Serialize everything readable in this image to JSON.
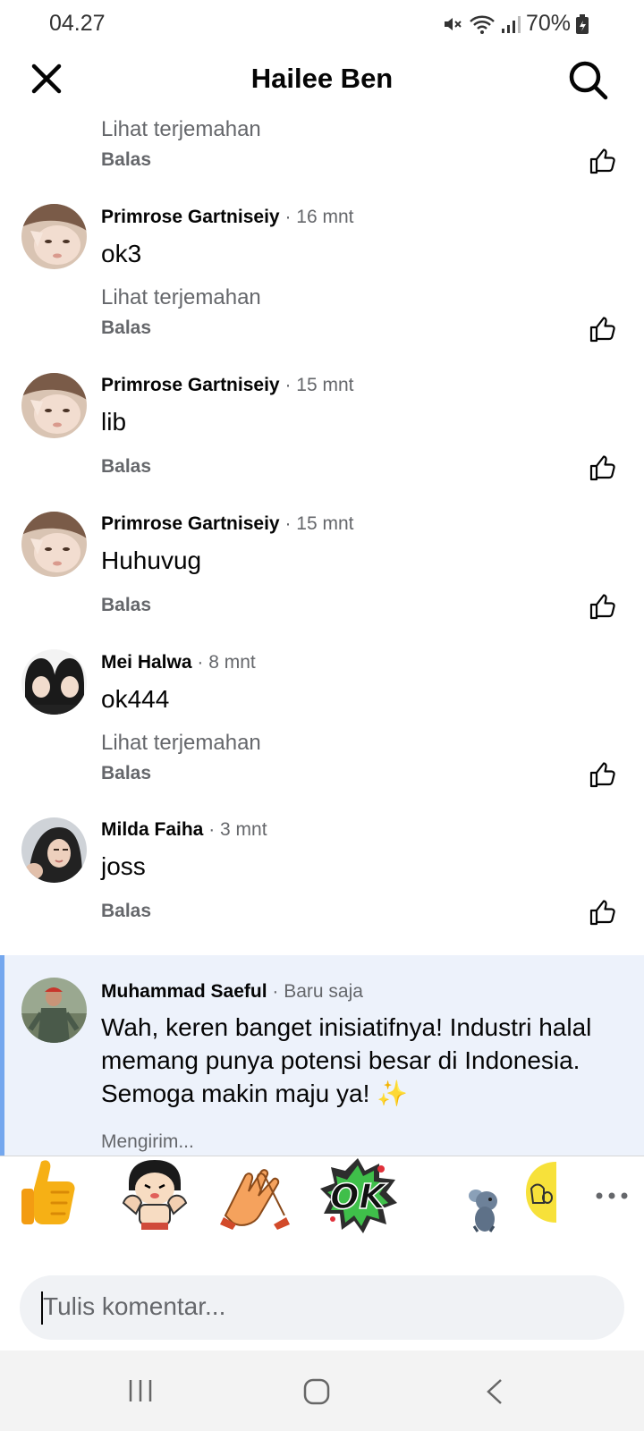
{
  "status": {
    "time": "04.27",
    "battery": "70%"
  },
  "header": {
    "title": "Hailee Ben"
  },
  "top_fragment": {
    "translate": "Lihat terjemahan",
    "reply": "Balas"
  },
  "comments": [
    {
      "author": "Primrose Gartniseiy",
      "time": "· 16 mnt",
      "text": "ok3",
      "translate": "Lihat terjemahan",
      "reply": "Balas"
    },
    {
      "author": "Primrose Gartniseiy",
      "time": "· 15 mnt",
      "text": "lib",
      "reply": "Balas"
    },
    {
      "author": "Primrose Gartniseiy",
      "time": "· 15 mnt",
      "text": "Huhuvug",
      "reply": "Balas"
    },
    {
      "author": "Mei Halwa",
      "time": "· 8 mnt",
      "text": "ok444",
      "translate": "Lihat terjemahan",
      "reply": "Balas"
    },
    {
      "author": "Milda Faiha",
      "time": "· 3 mnt",
      "text": "joss",
      "reply": "Balas"
    }
  ],
  "new_comment": {
    "author": "Muhammad Saeful",
    "time": "· Baru saja",
    "text": "Wah, keren banget inisiatifnya! Industri halal memang punya potensi besar di Indonesia. Semoga makin maju ya! ✨",
    "status": "Mengirim..."
  },
  "stickers": [
    "thumbs-up-sticker",
    "flexing-boy-sticker",
    "clapping-hands-sticker",
    "ok-burst-sticker",
    "mouse-sticker",
    "yellow-hand-sticker"
  ],
  "input": {
    "placeholder": "Tulis komentar..."
  },
  "colors": {
    "highlight_bg": "#edf2fb",
    "highlight_border": "#74a7ee",
    "secondary_text": "#65676b",
    "input_bg": "#f0f2f5"
  }
}
